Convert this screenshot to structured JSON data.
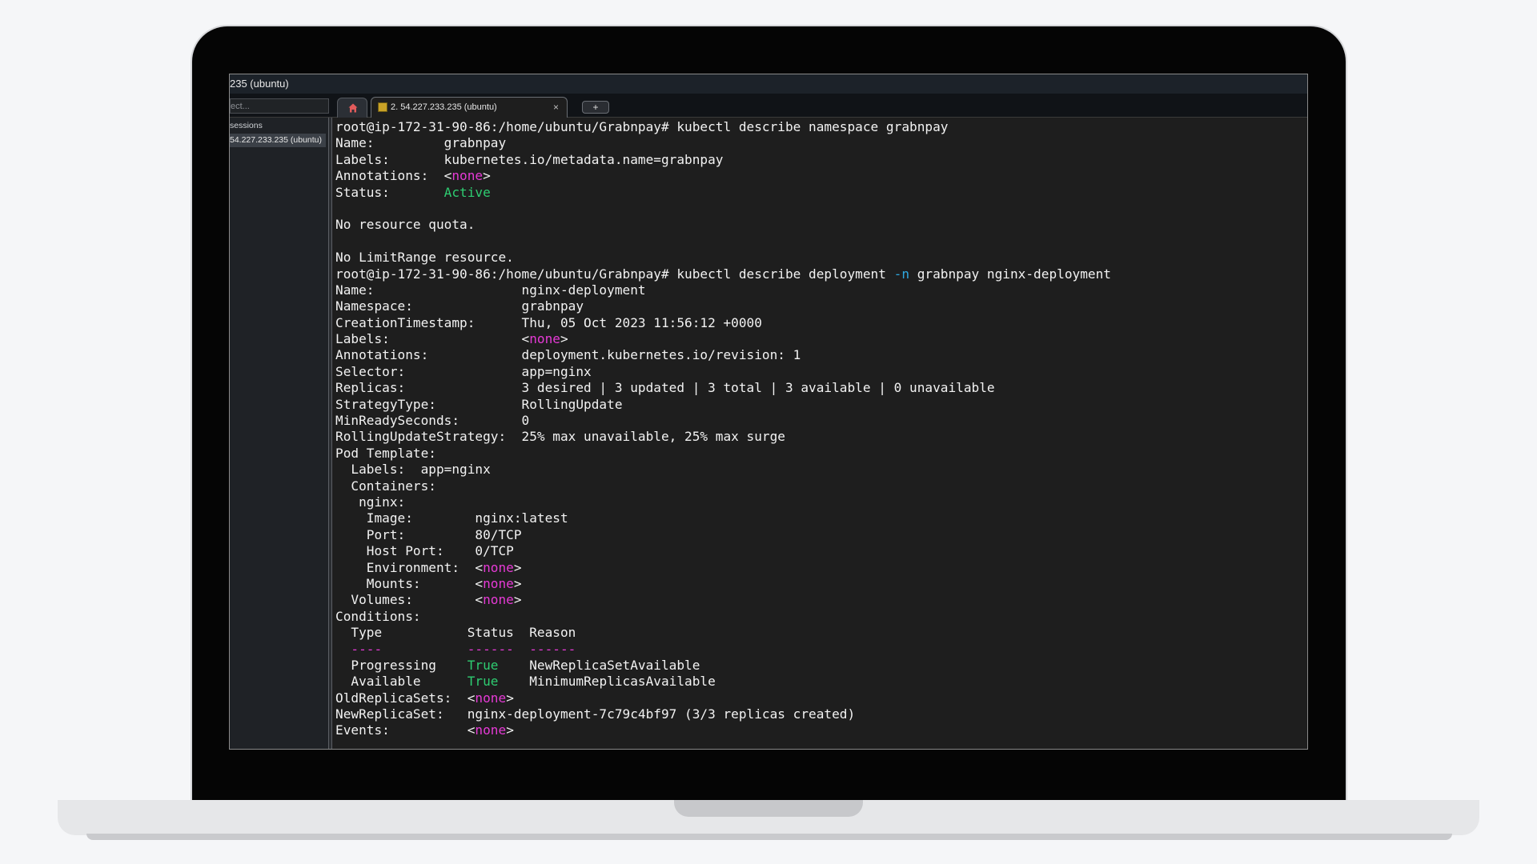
{
  "window": {
    "title": "235 (ubuntu)"
  },
  "toolbar": {
    "quick_connect_placeholder": "ect...",
    "new_tab_label": "+"
  },
  "tabs": [
    {
      "label": "2. 54.227.233.235 (ubuntu)",
      "close": "×"
    }
  ],
  "sidebar": {
    "heading": "sessions",
    "items": [
      {
        "label": "54.227.233.235 (ubuntu)"
      }
    ]
  },
  "terminal": {
    "lines": [
      [
        {
          "t": "root@ip-172-31-90-86:/home/ubuntu/Grabnpay# kubectl describe namespace grabnpay"
        }
      ],
      [
        {
          "t": "Name:         grabnpay"
        }
      ],
      [
        {
          "t": "Labels:       kubernetes.io/metadata.name=grabnpay"
        }
      ],
      [
        {
          "t": "Annotations:  <"
        },
        {
          "t": "none",
          "c": "m"
        },
        {
          "t": ">"
        }
      ],
      [
        {
          "t": "Status:       "
        },
        {
          "t": "Active",
          "c": "g"
        }
      ],
      [
        {
          "t": ""
        }
      ],
      [
        {
          "t": "No resource quota."
        }
      ],
      [
        {
          "t": ""
        }
      ],
      [
        {
          "t": "No LimitRange resource."
        }
      ],
      [
        {
          "t": "root@ip-172-31-90-86:/home/ubuntu/Grabnpay# kubectl describe deployment "
        },
        {
          "t": "-n",
          "c": "c"
        },
        {
          "t": " grabnpay nginx-deployment"
        }
      ],
      [
        {
          "t": "Name:                   nginx-deployment"
        }
      ],
      [
        {
          "t": "Namespace:              grabnpay"
        }
      ],
      [
        {
          "t": "CreationTimestamp:      Thu, 05 Oct 2023 11:56:12 +0000"
        }
      ],
      [
        {
          "t": "Labels:                 <"
        },
        {
          "t": "none",
          "c": "m"
        },
        {
          "t": ">"
        }
      ],
      [
        {
          "t": "Annotations:            deployment.kubernetes.io/revision: 1"
        }
      ],
      [
        {
          "t": "Selector:               app=nginx"
        }
      ],
      [
        {
          "t": "Replicas:               3 desired | 3 updated | 3 total | 3 available | 0 unavailable"
        }
      ],
      [
        {
          "t": "StrategyType:           RollingUpdate"
        }
      ],
      [
        {
          "t": "MinReadySeconds:        0"
        }
      ],
      [
        {
          "t": "RollingUpdateStrategy:  25% max unavailable, 25% max surge"
        }
      ],
      [
        {
          "t": "Pod Template:"
        }
      ],
      [
        {
          "t": "  Labels:  app=nginx"
        }
      ],
      [
        {
          "t": "  Containers:"
        }
      ],
      [
        {
          "t": "   nginx:"
        }
      ],
      [
        {
          "t": "    Image:        nginx:latest"
        }
      ],
      [
        {
          "t": "    Port:         80/TCP"
        }
      ],
      [
        {
          "t": "    Host Port:    0/TCP"
        }
      ],
      [
        {
          "t": "    Environment:  <"
        },
        {
          "t": "none",
          "c": "m"
        },
        {
          "t": ">"
        }
      ],
      [
        {
          "t": "    Mounts:       <"
        },
        {
          "t": "none",
          "c": "m"
        },
        {
          "t": ">"
        }
      ],
      [
        {
          "t": "  Volumes:        <"
        },
        {
          "t": "none",
          "c": "m"
        },
        {
          "t": ">"
        }
      ],
      [
        {
          "t": "Conditions:"
        }
      ],
      [
        {
          "t": "  Type           Status  Reason"
        }
      ],
      [
        {
          "t": "  ----           ------  ------",
          "c": "m"
        }
      ],
      [
        {
          "t": "  Progressing    "
        },
        {
          "t": "True",
          "c": "g"
        },
        {
          "t": "    NewReplicaSetAvailable"
        }
      ],
      [
        {
          "t": "  Available      "
        },
        {
          "t": "True",
          "c": "g"
        },
        {
          "t": "    MinimumReplicasAvailable"
        }
      ],
      [
        {
          "t": "OldReplicaSets:  <"
        },
        {
          "t": "none",
          "c": "m"
        },
        {
          "t": ">"
        }
      ],
      [
        {
          "t": "NewReplicaSet:   nginx-deployment-7c79c4bf97 (3/3 replicas created)"
        }
      ],
      [
        {
          "t": "Events:          <"
        },
        {
          "t": "none",
          "c": "m"
        },
        {
          "t": ">"
        }
      ]
    ]
  },
  "colors": {
    "keyword_none": "#e63ad6",
    "status_true": "#2ecc71",
    "flag": "#2fa8e0"
  }
}
